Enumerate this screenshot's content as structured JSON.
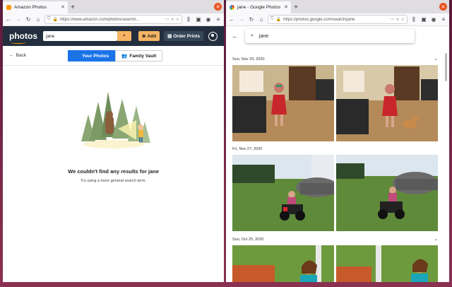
{
  "left": {
    "tab_title": "Amazon Photos",
    "url": "https://www.amazon.com/photos/search/...",
    "header": {
      "logo_text": "photos",
      "search_value": "jane",
      "add_label": "Add",
      "order_prints_label": "Order Prints"
    },
    "subnav": {
      "back_label": "Back",
      "tabs": [
        {
          "label": "Your Photos",
          "active": true
        },
        {
          "label": "Family Vault",
          "active": false
        }
      ]
    },
    "empty": {
      "title": "We couldn't find any results for jane",
      "subtitle": "Try using a more general search term."
    }
  },
  "right": {
    "tab_title": "jane - Google Photos",
    "url": "https://photos.google.com/search/jane",
    "search_value": "jane",
    "groups": [
      {
        "date": "Sun, Nov 29, 2020"
      },
      {
        "date": "Fri, Nov 27, 2020"
      },
      {
        "date": "Sun, Oct 25, 2020"
      }
    ]
  },
  "colors": {
    "amazon_header": "#232f3e",
    "amazon_orange": "#f5b464",
    "google_blue": "#1a73e8",
    "desktop": "#6a2040"
  }
}
